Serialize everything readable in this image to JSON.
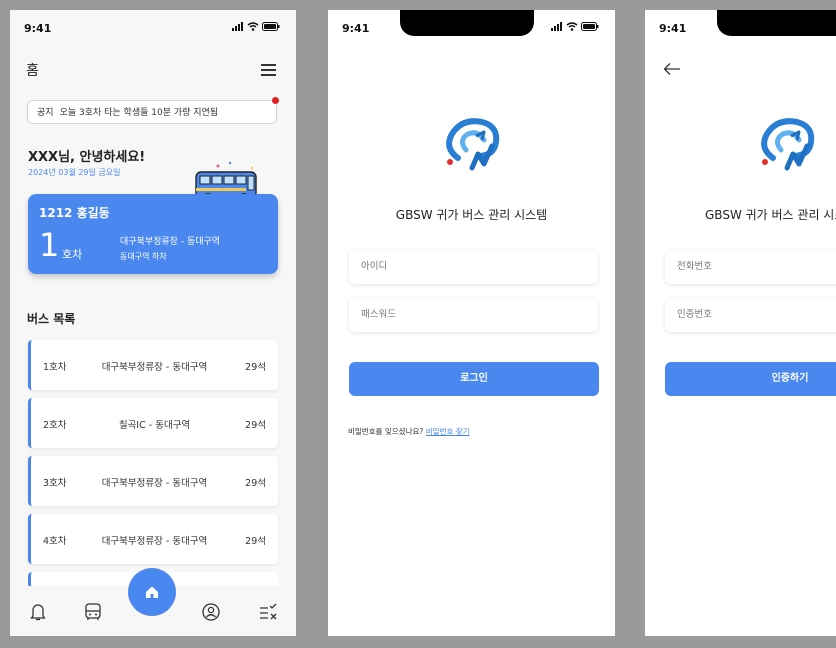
{
  "status": {
    "time": "9:41"
  },
  "home": {
    "title": "홈",
    "notice": {
      "label": "공지",
      "text": "오늘 3호차 타는 학생들 10분 가량 지연됨"
    },
    "greeting": "XXX님, 안녕하세요!",
    "date": "2024년 03월 29일 금요일",
    "card": {
      "name": "1212 홍길동",
      "bus_number": "1",
      "bus_unit": "호차",
      "route": "대구북부정류장 - 동대구역",
      "stop": "동대구역 하차"
    },
    "list_title": "버스 목록",
    "buses": [
      {
        "num": "1호차",
        "route": "대구북부정류장 - 동대구역",
        "seats": "29석"
      },
      {
        "num": "2호차",
        "route": "칠곡IC - 동대구역",
        "seats": "29석"
      },
      {
        "num": "3호차",
        "route": "대구북부정류장 - 동대구역",
        "seats": "29석"
      },
      {
        "num": "4호차",
        "route": "대구북부정류장 - 동대구역",
        "seats": "29석"
      }
    ],
    "nav": [
      "bell-icon",
      "bus-icon",
      "home-icon",
      "user-icon",
      "list-check-icon"
    ]
  },
  "login": {
    "app_title": "GBSW 귀가 버스 관리 시스템",
    "id_placeholder": "아이디",
    "pw_placeholder": "패스워드",
    "login_button": "로그인",
    "forgot_text": "비밀번호를 잊으셨나요?",
    "forgot_link": "비밀번호 찾기"
  },
  "verify": {
    "app_title": "GBSW 귀가 버스 관리 시스템",
    "phone_placeholder": "전화번호",
    "code_placeholder": "인증번호",
    "verify_button": "인증하기"
  },
  "colors": {
    "accent": "#4a88f0",
    "background": "#9a9a9a",
    "notice_dot": "#e02020"
  }
}
